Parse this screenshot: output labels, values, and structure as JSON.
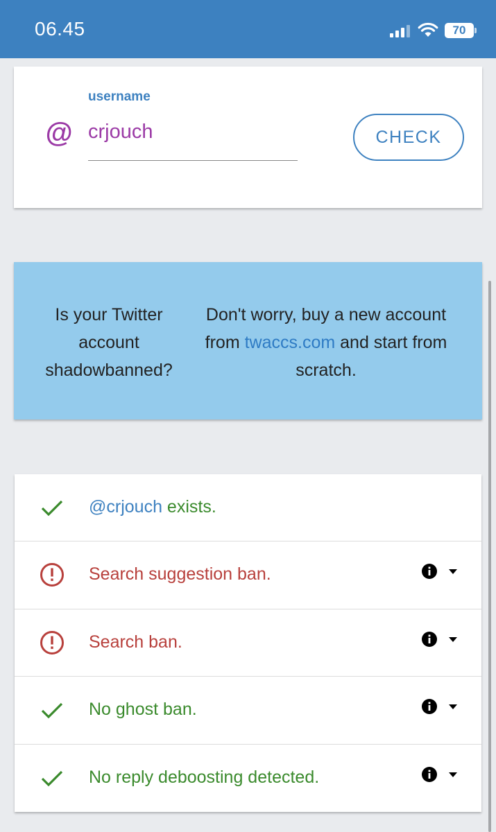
{
  "status_bar": {
    "time": "06.45",
    "battery": "70"
  },
  "user_form": {
    "label": "username",
    "at_symbol": "@",
    "input_value": "crjouch",
    "check_label": "CHECK"
  },
  "promo": {
    "left_text": "Is your Twitter account shadowbanned?",
    "right_prefix": "Don't worry, buy a new account from ",
    "right_link": "twaccs.com",
    "right_suffix": " and start from scratch."
  },
  "results": [
    {
      "status": "ok",
      "handle": "@crjouch",
      "text": " exists.",
      "has_info": false
    },
    {
      "status": "bad",
      "handle": "",
      "text": "Search suggestion ban.",
      "has_info": true
    },
    {
      "status": "bad",
      "handle": "",
      "text": "Search ban.",
      "has_info": true
    },
    {
      "status": "ok",
      "handle": "",
      "text": "No ghost ban.",
      "has_info": true
    },
    {
      "status": "ok",
      "handle": "",
      "text": "No reply deboosting detected.",
      "has_info": true
    }
  ],
  "colors": {
    "primary": "#3d81c0",
    "accent": "#9b3aa6",
    "ok": "#3a8a2c",
    "bad": "#b8403c",
    "promo_bg": "#94cbec"
  },
  "icons": {
    "ok": "check-icon",
    "bad": "alert-circle-icon",
    "info": "info-icon",
    "caret": "caret-down-icon"
  }
}
